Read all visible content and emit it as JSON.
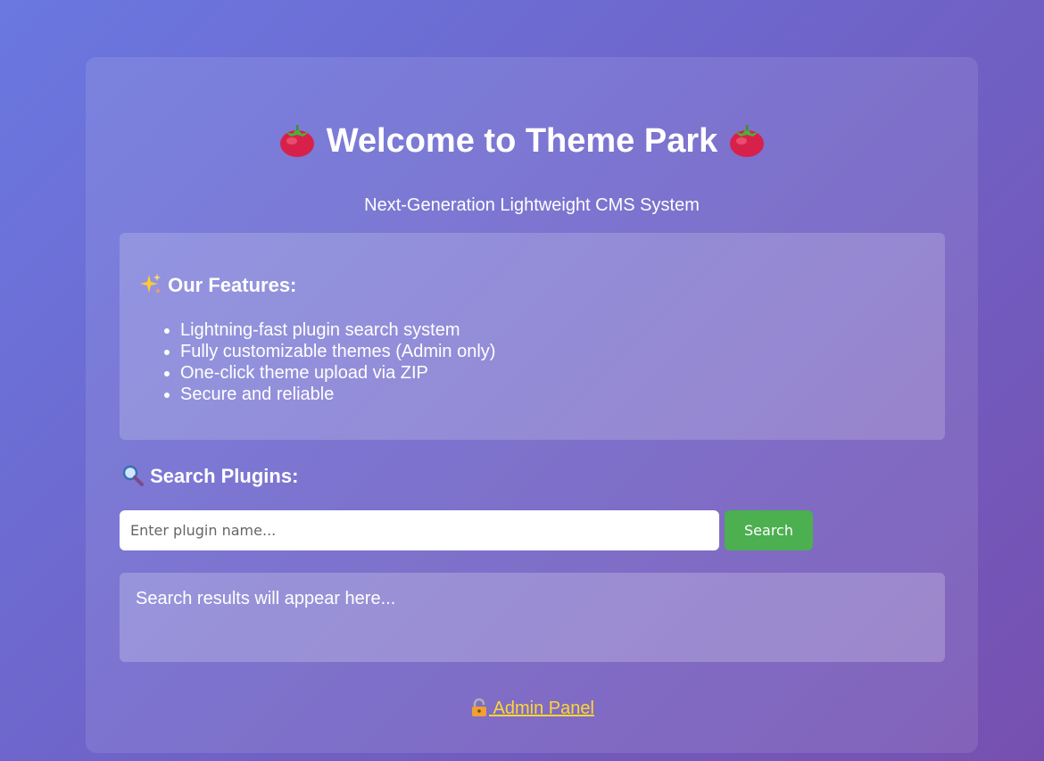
{
  "header": {
    "title": "Welcome to Theme Park",
    "subtitle": "Next-Generation Lightweight CMS System",
    "title_icon": "tomato-icon"
  },
  "features": {
    "icon": "sparkles-icon",
    "heading": "Our Features:",
    "items": [
      "Lightning-fast plugin search system",
      "Fully customizable themes (Admin only)",
      "One-click theme upload via ZIP",
      "Secure and reliable"
    ]
  },
  "search": {
    "icon": "magnifier-icon",
    "heading": "Search Plugins:",
    "placeholder": "Enter plugin name...",
    "value": "",
    "button_label": "Search",
    "button_color": "#4caf50"
  },
  "results": {
    "text": "Search results will appear here..."
  },
  "admin": {
    "icon": "lock-icon",
    "label": "Admin Panel",
    "color": "#ffd633"
  }
}
